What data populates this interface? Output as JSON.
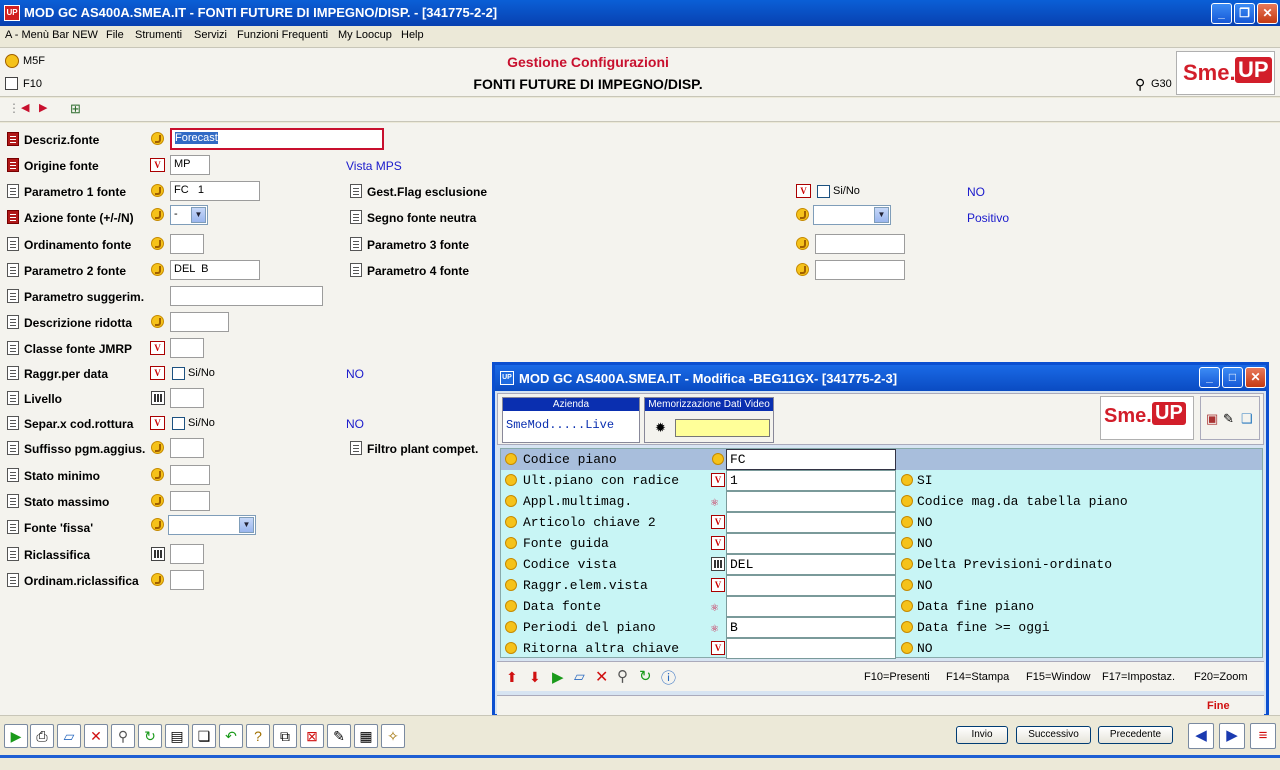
{
  "window": {
    "title": "MOD GC AS400A.SMEA.IT - FONTI FUTURE DI IMPEGNO/DISP. - [341775-2-2]",
    "app_icon": "UP"
  },
  "menu": [
    "A - Menù Bar NEW",
    "File",
    "Strumenti",
    "Servizi",
    "Funzioni Frequenti",
    "My Loocup",
    "Help"
  ],
  "header": {
    "left_top": "M5F",
    "left_bottom": "F10",
    "title": "Gestione Configurazioni",
    "subtitle": "FONTI FUTURE DI IMPEGNO/DISP.",
    "right_code": "G30",
    "logo_a": "Sme.",
    "logo_b": "UP"
  },
  "form": {
    "descriz_fonte": {
      "label": "Descriz.fonte",
      "value": "Forecast"
    },
    "origine_fonte": {
      "label": "Origine fonte",
      "value": "MP",
      "desc": "Vista MPS"
    },
    "parametro1": {
      "label": "Parametro 1 fonte",
      "value": "FC   1"
    },
    "azione_fonte": {
      "label": "Azione fonte (+/-/N)",
      "value": "-"
    },
    "ordinamento": {
      "label": "Ordinamento fonte",
      "value": ""
    },
    "parametro2": {
      "label": "Parametro 2 fonte",
      "value": "DEL  B"
    },
    "parametro_sugg": {
      "label": "Parametro suggerim.",
      "value": ""
    },
    "descr_ridotta": {
      "label": "Descrizione ridotta",
      "value": ""
    },
    "classe_jmrp": {
      "label": "Classe fonte JMRP",
      "value": ""
    },
    "raggr_data": {
      "label": "Raggr.per data",
      "check": "Si/No",
      "desc": "NO"
    },
    "livello": {
      "label": "Livello",
      "value": ""
    },
    "separ_rottura": {
      "label": "Separ.x cod.rottura",
      "check": "Si/No",
      "desc": "NO"
    },
    "suffisso": {
      "label": "Suffisso pgm.aggius.",
      "value": ""
    },
    "stato_minimo": {
      "label": "Stato minimo",
      "value": ""
    },
    "stato_massimo": {
      "label": "Stato massimo",
      "value": ""
    },
    "fonte_fissa": {
      "label": "Fonte 'fissa'",
      "value": ""
    },
    "riclassifica": {
      "label": "Riclassifica",
      "value": ""
    },
    "ordinam_ricl": {
      "label": "Ordinam.riclassifica",
      "value": ""
    },
    "gest_flag": {
      "label": "Gest.Flag esclusione",
      "check": "Si/No",
      "desc": "NO"
    },
    "segno_neutra": {
      "label": "Segno fonte neutra",
      "value": "",
      "desc": "Positivo"
    },
    "parametro3": {
      "label": "Parametro 3 fonte",
      "value": ""
    },
    "parametro4": {
      "label": "Parametro 4 fonte",
      "value": ""
    },
    "filtro_plant": {
      "label": "Filtro plant compet."
    }
  },
  "child": {
    "title": "MOD GC AS400A.SMEA.IT -  Modifica -BEG11GX- [341775-2-3]",
    "azienda_label": "Azienda",
    "azienda_value": "SmeMod.....Live",
    "memo_label": "Memorizzazione Dati Video",
    "rows": [
      {
        "label": "Codice piano",
        "value": "FC",
        "desc": ""
      },
      {
        "label": "Ult.piano con radice",
        "value": "1",
        "desc": "SI"
      },
      {
        "label": "Appl.multimag.",
        "value": "",
        "desc": "Codice mag.da tabella piano"
      },
      {
        "label": "Articolo chiave 2",
        "value": "",
        "desc": "NO"
      },
      {
        "label": "Fonte guida",
        "value": "",
        "desc": "NO"
      },
      {
        "label": "Codice vista",
        "value": "DEL",
        "desc": "Delta Previsioni-ordinato"
      },
      {
        "label": "Raggr.elem.vista",
        "value": "",
        "desc": "NO"
      },
      {
        "label": "Data fonte",
        "value": "",
        "desc": "Data fine piano"
      },
      {
        "label": "Periodi del piano",
        "value": "B",
        "desc": "Data fine >= oggi"
      },
      {
        "label": "Ritorna altra chiave",
        "value": "",
        "desc": "NO"
      }
    ],
    "fkeys": [
      "F10=Presenti",
      "F14=Stampa",
      "F15=Window",
      "F17=Impostaz.",
      "F20=Zoom"
    ],
    "status": "Fine"
  },
  "bottom": {
    "buttons": [
      "Invio",
      "Successivo",
      "Precedente"
    ]
  },
  "colors": {
    "accent": "#c8102e",
    "titlebar": "#0a4bc2",
    "grid_bg": "#c8f5f5",
    "selected_row": "#a8bedc"
  }
}
